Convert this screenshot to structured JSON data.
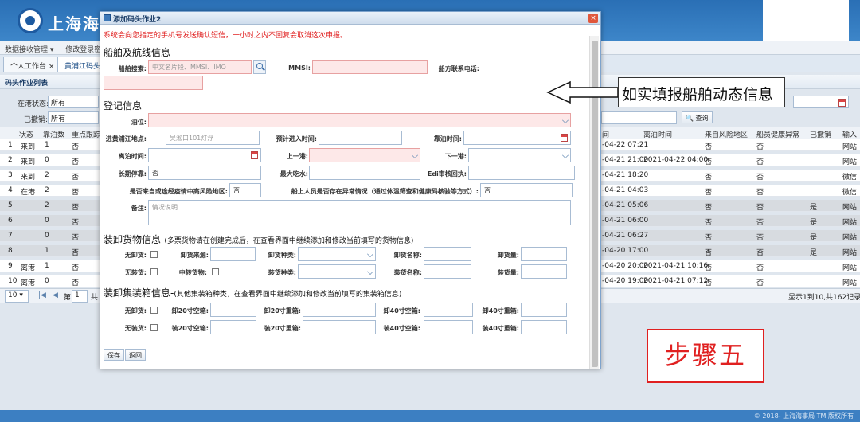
{
  "header": {
    "title": "上海海事"
  },
  "menu": {
    "items": [
      "数据接收管理 ▾",
      "修改登录密码"
    ]
  },
  "tabs": [
    {
      "label": "个人工作台 ×"
    },
    {
      "label": "黄浦江码头"
    }
  ],
  "panel": {
    "title": "码头作业列表"
  },
  "filters": {
    "port_status_label": "在港状态:",
    "port_status_value": "所有",
    "revoked_label": "已撤销:",
    "revoked_value": "所有",
    "query_button": "查询"
  },
  "table": {
    "left_headers": [
      "状态",
      "靠泊数",
      "重点跟踪"
    ],
    "right_headers": [
      "间",
      "离泊时间",
      "来自风险地区",
      "船员健康异常",
      "已撤销",
      "输入"
    ],
    "rows": [
      {
        "n": "1",
        "status": "来到",
        "berth": "1",
        "track": "否",
        "time": "-04-22 07:21",
        "leave": "",
        "risk": "否",
        "health": "否",
        "rev": "",
        "input": "网站"
      },
      {
        "n": "2",
        "status": "来到",
        "berth": "0",
        "track": "否",
        "time": "-04-21 21:00",
        "leave": "2021-04-22 04:00",
        "risk": "否",
        "health": "否",
        "rev": "",
        "input": "网站"
      },
      {
        "n": "3",
        "status": "来到",
        "berth": "2",
        "track": "否",
        "time": "-04-21 18:20",
        "leave": "",
        "risk": "否",
        "health": "否",
        "rev": "",
        "input": "微信"
      },
      {
        "n": "4",
        "status": "在港",
        "berth": "2",
        "track": "否",
        "time": "-04-21 04:03",
        "leave": "",
        "risk": "否",
        "health": "否",
        "rev": "",
        "input": "微信"
      },
      {
        "n": "5",
        "status": "",
        "berth": "2",
        "track": "否",
        "time": "-04-21 05:06",
        "leave": "",
        "risk": "否",
        "health": "否",
        "rev": "是",
        "input": "网站"
      },
      {
        "n": "6",
        "status": "",
        "berth": "0",
        "track": "否",
        "time": "-04-21 06:00",
        "leave": "",
        "risk": "否",
        "health": "否",
        "rev": "是",
        "input": "网站"
      },
      {
        "n": "7",
        "status": "",
        "berth": "0",
        "track": "否",
        "time": "-04-21 06:27",
        "leave": "",
        "risk": "否",
        "health": "否",
        "rev": "是",
        "input": "网站"
      },
      {
        "n": "8",
        "status": "",
        "berth": "1",
        "track": "否",
        "time": "-04-20 17:00",
        "leave": "",
        "risk": "否",
        "health": "否",
        "rev": "是",
        "input": "网站"
      },
      {
        "n": "9",
        "status": "离港",
        "berth": "1",
        "track": "否",
        "time": "-04-20 20:00",
        "leave": "2021-04-21 10:16",
        "risk": "否",
        "health": "否",
        "rev": "",
        "input": "网站"
      },
      {
        "n": "10",
        "status": "离港",
        "berth": "0",
        "track": "否",
        "time": "-04-20 19:00",
        "leave": "2021-04-21 07:12",
        "risk": "否",
        "health": "否",
        "rev": "",
        "input": "网站"
      }
    ]
  },
  "pager": {
    "size": "10 ▾",
    "page_label": "第",
    "page": "1",
    "of": "共",
    "summary": "显示1到10,共162记录"
  },
  "footer": {
    "copyright": "© 2018- 上海海事局 TM 版权所有"
  },
  "dialog": {
    "title": "添加码头作业2",
    "notice": "系统会向您指定的手机号发送确认短信，一小时之内不回复会取消这次申报。",
    "sections": {
      "ship": "船舶及航线信息",
      "reg": "登记信息",
      "cargo": "装卸货物信息-",
      "cargo_note": "(多票货物请在创建完成后，在查看界面中继续添加和修改当前填写的货物信息)",
      "container": "装卸集装箱信息-",
      "container_note": "(其他集装箱种类，在查看界面中继续添加和修改当前填写的集装箱信息)"
    },
    "fields": {
      "ship_search": "船舶搜索:",
      "ship_search_ph": "中文名片段、MMSI、IMO",
      "mmsi": "MMSI:",
      "phone": "船方联系电话:",
      "berth": "泊位:",
      "entry_place": "进黄浦江地点:",
      "entry_place_value": "吴淞口101灯浮",
      "eta": "预计进入时间:",
      "berth_time": "靠泊时间:",
      "leave_time": "离泊时间:",
      "prev_port": "上一港:",
      "next_port": "下一港:",
      "long_stay": "长期停靠:",
      "long_stay_value": "否",
      "max_draft": "最大吃水:",
      "edi": "Edi审核回执:",
      "risk": "是否来自或途经疫情中高风险地区:",
      "risk_value": "否",
      "crew": "船上人员是否存在异常情况（通过体温筛查和健康码核验等方式）:",
      "crew_value": "否",
      "remark": "备注:",
      "remark_ph": "情况说明",
      "no_unload": "无卸货:",
      "unload_src": "卸货来源:",
      "unload_type": "卸货种类:",
      "unload_name": "卸货名称:",
      "unload_qty": "卸货量:",
      "no_load": "无装货:",
      "transit": "中转货物:",
      "load_type": "装货种类:",
      "load_name": "装货名称:",
      "load_qty": "装货量:",
      "no_unload2": "无卸货:",
      "u20e": "卸20寸空箱:",
      "u20f": "卸20寸重箱:",
      "u40e": "卸40寸空箱:",
      "u40f": "卸40寸重箱:",
      "no_load2": "无装货:",
      "l20e": "装20寸空箱:",
      "l20f": "装20寸重箱:",
      "l40e": "装40寸空箱:",
      "l40f": "装40寸重箱:"
    },
    "buttons": {
      "save": "保存",
      "back": "返回"
    }
  },
  "annotation": {
    "text": "如实填报船舶动态信息"
  },
  "step": {
    "text": "步骤五"
  }
}
